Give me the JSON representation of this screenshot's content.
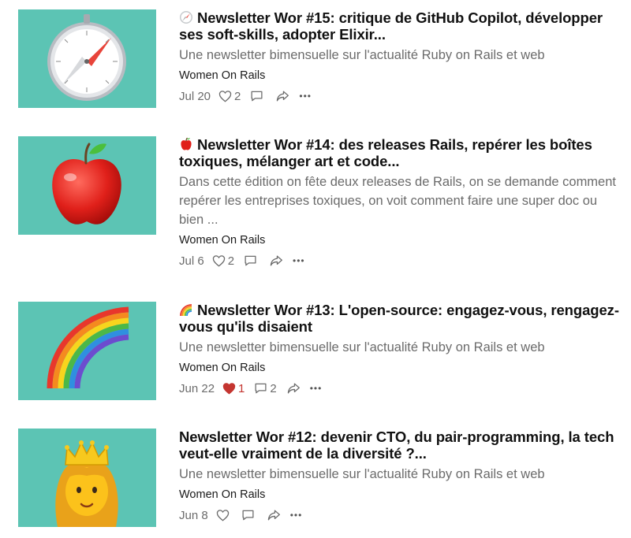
{
  "posts": [
    {
      "thumb_icon": "compass-icon",
      "title_emoji": "compass-emoji",
      "title": "Newsletter Wor #15: critique de GitHub Copilot, développer ses soft-skills, adopter Elixir...",
      "subtitle": "Une newsletter bimensuelle sur l'actualité Ruby on Rails et web",
      "author": "Women On Rails",
      "date": "Jul 20",
      "likes": "2",
      "liked": false,
      "comments": "",
      "more": "•••"
    },
    {
      "thumb_icon": "apple-icon",
      "title_emoji": "apple-emoji",
      "title": "Newsletter Wor #14: des releases Rails, repérer les boîtes toxiques, mélanger art et code...",
      "subtitle": "Dans cette édition on fête deux releases de Rails, on se demande comment repérer les entreprises toxiques, on voit comment faire une super doc ou bien ...",
      "author": "Women On Rails",
      "date": "Jul 6",
      "likes": "2",
      "liked": false,
      "comments": "",
      "more": "•••"
    },
    {
      "thumb_icon": "rainbow-icon",
      "title_emoji": "rainbow-emoji",
      "title": "Newsletter Wor #13: L'open-source: engagez-vous, rengagez-vous qu'ils disaient",
      "subtitle": "Une newsletter bimensuelle sur l'actualité Ruby on Rails et web",
      "author": "Women On Rails",
      "date": "Jun 22",
      "likes": "1",
      "liked": true,
      "comments": "2",
      "more": "•••"
    },
    {
      "thumb_icon": "princess-icon",
      "title_emoji": "",
      "title": "Newsletter Wor #12: devenir CTO, du pair-programming, la tech veut-elle vraiment de la diversité ?...",
      "subtitle": "Une newsletter bimensuelle sur l'actualité Ruby on Rails et web",
      "author": "Women On Rails",
      "date": "Jun 8",
      "likes": "",
      "liked": false,
      "comments": "",
      "more": "•••"
    }
  ],
  "colors": {
    "thumb_bg": "#5cc4b4",
    "liked_red": "#c43530",
    "muted": "#6b6b6b"
  }
}
